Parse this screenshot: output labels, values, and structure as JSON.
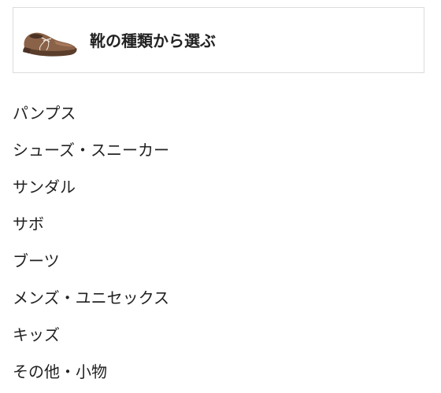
{
  "header": {
    "title": "靴の種類から選ぶ",
    "thumbnail_icon": "shoe-icon"
  },
  "categories": [
    {
      "label": "パンプス"
    },
    {
      "label": "シューズ・スニーカー"
    },
    {
      "label": "サンダル"
    },
    {
      "label": "サボ"
    },
    {
      "label": "ブーツ"
    },
    {
      "label": "メンズ・ユニセックス"
    },
    {
      "label": "キッズ"
    },
    {
      "label": "その他・小物"
    }
  ],
  "colors": {
    "text": "#222222",
    "border": "#dcdcdc",
    "shoe_leather": "#8a6248"
  }
}
